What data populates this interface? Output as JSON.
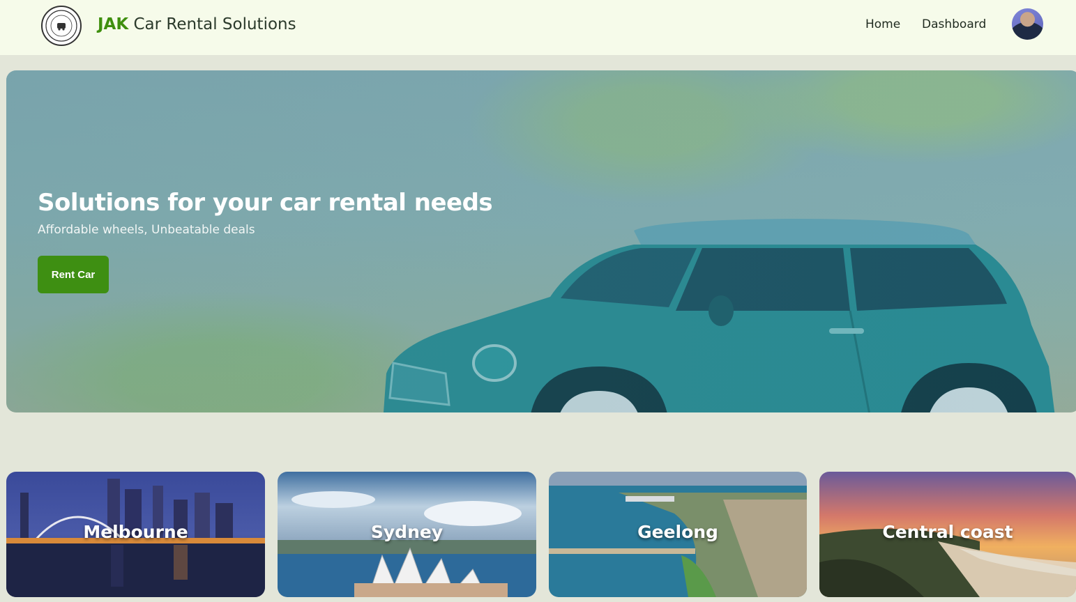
{
  "header": {
    "brand_accent": "JAK",
    "brand_rest": " Car Rental Solutions",
    "logo_text": "JAK",
    "nav": [
      {
        "label": "Home"
      },
      {
        "label": "Dashboard"
      }
    ]
  },
  "hero": {
    "title": "Solutions for your car rental needs",
    "subtitle": "Affordable wheels, Unbeatable deals",
    "button_label": "Rent Car"
  },
  "cities": [
    {
      "name": "Melbourne"
    },
    {
      "name": "Sydney"
    },
    {
      "name": "Geelong"
    },
    {
      "name": "Central coast"
    }
  ],
  "colors": {
    "accent": "#3e8f12",
    "header_bg": "#f6fbea",
    "page_bg": "#e3e6d9"
  }
}
